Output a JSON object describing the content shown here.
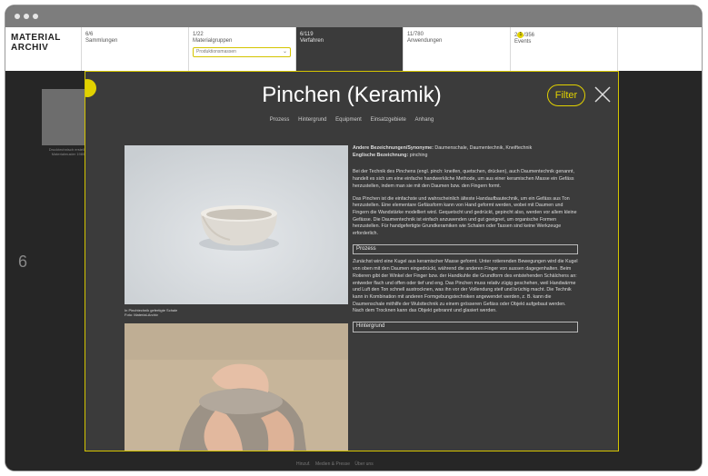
{
  "brand": "MATERIAL\nARCHIV",
  "nav": [
    {
      "count": "6/6",
      "label": "Sammlungen",
      "active": false
    },
    {
      "count": "1/22",
      "label": "Materialgruppen",
      "select": "Produktionsmassen",
      "active": false
    },
    {
      "count": "6/119",
      "label": "Verfahren",
      "active": true
    },
    {
      "count": "11/780",
      "label": "Anwendungen",
      "active": false
    },
    {
      "count_prefix": "2",
      "count_badge": "1",
      "count_suffix": "/356",
      "label": "Events",
      "active": false
    }
  ],
  "background": {
    "caption": "Drucktechnisch erstellte Materialmuster 1980",
    "number": "6",
    "footer": [
      "Hinzuf.",
      "Medien & Presse",
      "Über uns"
    ]
  },
  "modal": {
    "title": "Pinchen (Keramik)",
    "filter_label": "Filter",
    "tabs": [
      "Prozess",
      "Hintergrund",
      "Equipment",
      "Einsatzgebiete",
      "Anhang"
    ],
    "image1_caption": "In Pinchtechnik gefertigte Schale\nFoto: Material-Archiv",
    "meta_label_1": "Andere Bezeichnungen/Synonyme:",
    "meta_value_1": "Daumenschale, Daumentechnik, Kneiftechnik",
    "meta_label_2": "Englische Bezeichnung:",
    "meta_value_2": "pinching",
    "para1": "Bei der Technik des Pinchens (engl. pinch: kneifen, quetschen, drücken), auch Daumentechnik genannt, handelt es sich um eine einfache handwerkliche Methode, um aus einer keramischen Masse ein Gefäss herzustellen, indem man sie mit den Daumen bzw. den Fingern formt.",
    "para2": "Das Pinchen ist die einfachste und wahrscheinlich älteste Handaufbautechnik, um ein Gefäss aus Ton herzustellen. Eine elementare Gefässform kann von Hand geformt werden, wobei mit Daumen und Fingern die Wandstärke modelliert wird. Gequetscht und gedrückt, gepincht also, werden vor allem kleine Gefässe. Die Daumentechnik ist einfach anzuwenden und gut geeignet, um organische Formen herzustellen. Für handgefertigte Grundkeramiken wie Schalen oder Tassen sind keine Werkzeuge erforderlich.",
    "section1_title": "Prozess",
    "para3": "Zunächst wird eine Kugel aus keramischer Masse geformt. Unter rotierenden Bewegungen wird die Kugel von oben mit den Daumen eingedrückt, während die anderen Finger von aussen dagegenhalten. Beim Rotieren gibt der Winkel der Finger bzw. der Handkuhle die Grundform des entstehenden Schälchens an: entweder flach und offen oder tief und eng. Das Pinchen muss relativ zügig geschehen, weil Handwärme und Luft den Ton schnell austrocknen, was ihn vor der Vollendung steif und brüchig macht. Die Technik kann in Kombination mit anderen Formgebungstechniken angewendet werden, z. B. kann die Daumenschale mithilfe der Wulsttechnik zu einem grösseren Gefäss oder Objekt aufgebaut werden. Nach dem Trocknen kann das Objekt gebrannt und glasiert werden.",
    "section2_title": "Hintergrund"
  },
  "colors": {
    "accent": "#e1d100",
    "modal_bg": "#3b3b3b",
    "page_bg": "#262626"
  }
}
